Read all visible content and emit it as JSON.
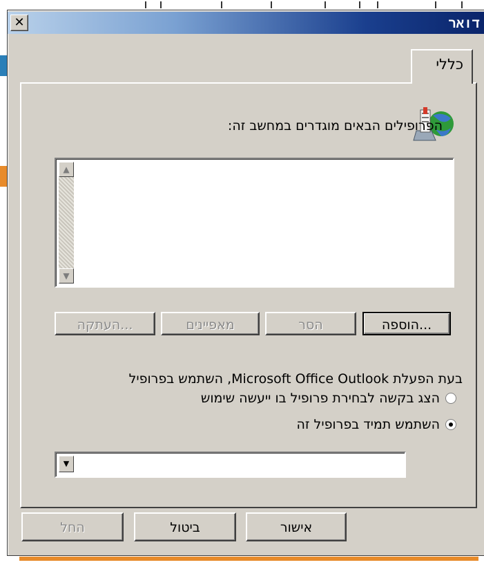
{
  "window": {
    "title": "דואר"
  },
  "tabs": [
    {
      "label": "כללי"
    }
  ],
  "intro_text": "הפרופילים הבאים מוגדרים במחשב זה:",
  "profile_list": {
    "items": []
  },
  "profile_buttons": {
    "add": "הוספה...",
    "remove": "הסר",
    "properties": "מאפיינים",
    "copy": "העתקה..."
  },
  "startup_label": "בעת הפעלת Microsoft Office Outlook, השתמש בפרופיל",
  "startup_options": [
    {
      "label": "הצג בקשה לבחירת פרופיל בו ייעשה שימוש",
      "checked": false
    },
    {
      "label": "השתמש תמיד בפרופיל זה",
      "checked": true
    }
  ],
  "profile_select": {
    "value": ""
  },
  "footer_buttons": {
    "ok": "אישור",
    "cancel": "ביטול",
    "apply": "החל"
  },
  "colors": {
    "title_bar_start": "#b9d1ea",
    "title_bar_end": "#0a246a",
    "dialog_face": "#d4d0c8"
  },
  "icons": {
    "close": "close-icon",
    "profile": "profiles-icon",
    "scroll_up": "scroll-up-icon",
    "scroll_down": "scroll-down-icon",
    "dropdown": "chevron-down-icon"
  }
}
